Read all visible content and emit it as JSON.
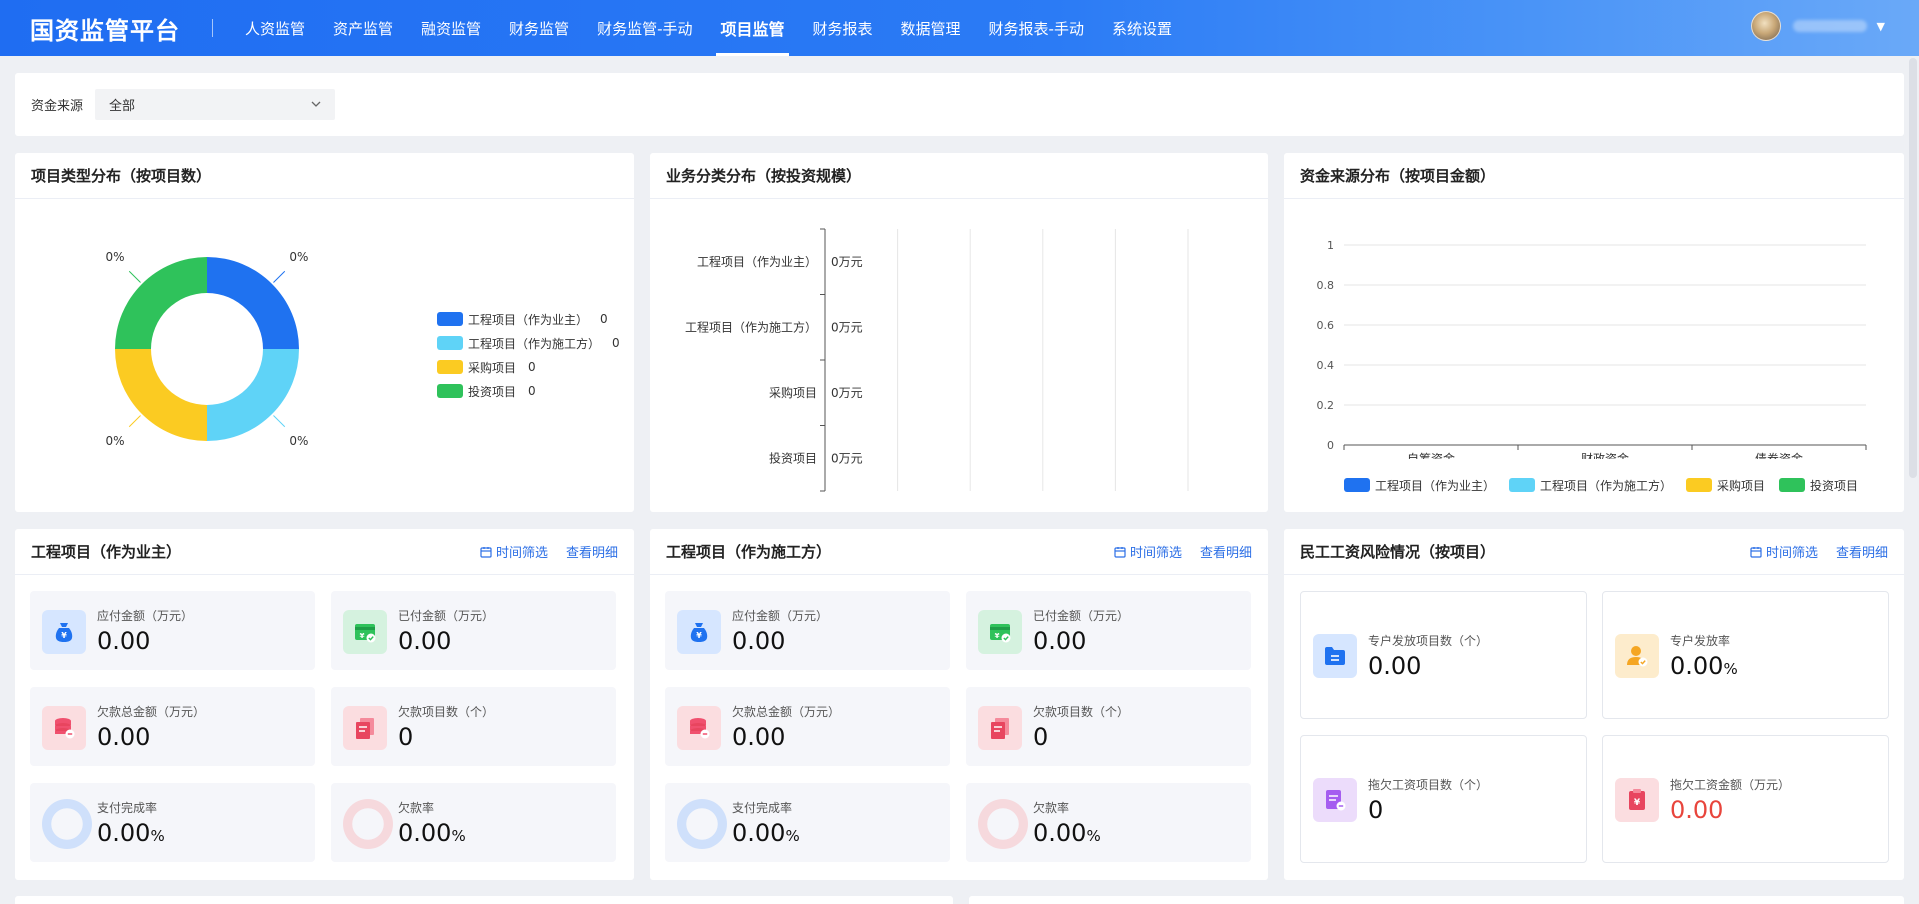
{
  "app": {
    "title": "国资监管平台"
  },
  "nav": [
    {
      "label": "人资监管",
      "active": false
    },
    {
      "label": "资产监管",
      "active": false
    },
    {
      "label": "融资监管",
      "active": false
    },
    {
      "label": "财务监管",
      "active": false
    },
    {
      "label": "财务监管-手动",
      "active": false
    },
    {
      "label": "项目监管",
      "active": true
    },
    {
      "label": "财务报表",
      "active": false
    },
    {
      "label": "数据管理",
      "active": false
    },
    {
      "label": "财务报表-手动",
      "active": false
    },
    {
      "label": "系统设置",
      "active": false
    }
  ],
  "filter": {
    "label": "资金来源",
    "value": "全部"
  },
  "colors": {
    "blue": "#1f72f0",
    "cyan": "#5fd3f7",
    "yellow": "#fbcb22",
    "green": "#2fc25b",
    "link": "#2c6fe6",
    "red": "#e8453c"
  },
  "panel1": {
    "title": "项目类型分布（按项目数）",
    "chart_data": {
      "type": "pie",
      "variant": "donut",
      "labels": [
        "工程项目（作为业主）",
        "工程项目（作为施工方）",
        "采购项目",
        "投资项目"
      ],
      "values": [
        0,
        0,
        0,
        0
      ],
      "slice_labels": [
        "0%",
        "0%",
        "0%",
        "0%"
      ],
      "legend_position": "right"
    }
  },
  "panel2": {
    "title": "业务分类分布（按投资规模）",
    "chart_data": {
      "type": "bar",
      "orientation": "horizontal",
      "categories": [
        "工程项目（作为业主）",
        "工程项目（作为施工方）",
        "采购项目",
        "投资项目"
      ],
      "values": [
        0,
        0,
        0,
        0
      ],
      "value_labels": [
        "0万元",
        "0万元",
        "0万元",
        "0万元"
      ],
      "xlim": [
        0,
        1
      ],
      "xticks": [
        "0",
        "0.2",
        "0.4",
        "0.6",
        "0.8",
        "1"
      ],
      "grid": true
    }
  },
  "panel3": {
    "title": "资金来源分布（按项目金额）",
    "chart_data": {
      "type": "bar",
      "categories": [
        "自筹资金",
        "财政资金",
        "债券资金"
      ],
      "series": [
        {
          "name": "工程项目（作为业主）",
          "values": [
            0,
            0,
            0
          ]
        },
        {
          "name": "工程项目（作为施工方）",
          "values": [
            0,
            0,
            0
          ]
        },
        {
          "name": "采购项目",
          "values": [
            0,
            0,
            0
          ]
        },
        {
          "name": "投资项目",
          "values": [
            0,
            0,
            0
          ]
        }
      ],
      "ylim": [
        0,
        1
      ],
      "yticks": [
        "0",
        "0.2",
        "0.4",
        "0.6",
        "0.8",
        "1"
      ],
      "grid": true,
      "legend_position": "bottom"
    }
  },
  "panel4": {
    "title": "工程项目（作为业主）",
    "filter_label": "时间筛选",
    "detail_label": "查看明细",
    "stats": [
      {
        "label": "应付金额（万元）",
        "value": "0.00"
      },
      {
        "label": "已付金额（万元）",
        "value": "0.00"
      },
      {
        "label": "欠款总金额（万元）",
        "value": "0.00"
      },
      {
        "label": "欠款项目数（个）",
        "value": "0"
      },
      {
        "label": "支付完成率",
        "value": "0.00",
        "unit": "%"
      },
      {
        "label": "欠款率",
        "value": "0.00",
        "unit": "%"
      }
    ]
  },
  "panel5": {
    "title": "工程项目（作为施工方）",
    "filter_label": "时间筛选",
    "detail_label": "查看明细",
    "stats": [
      {
        "label": "应付金额（万元）",
        "value": "0.00"
      },
      {
        "label": "已付金额（万元）",
        "value": "0.00"
      },
      {
        "label": "欠款总金额（万元）",
        "value": "0.00"
      },
      {
        "label": "欠款项目数（个）",
        "value": "0"
      },
      {
        "label": "支付完成率",
        "value": "0.00",
        "unit": "%"
      },
      {
        "label": "欠款率",
        "value": "0.00",
        "unit": "%"
      }
    ]
  },
  "panel6": {
    "title": "民工工资风险情况（按项目）",
    "filter_label": "时间筛选",
    "detail_label": "查看明细",
    "stats": [
      {
        "label": "专户发放项目数（个）",
        "value": "0.00"
      },
      {
        "label": "专户发放率",
        "value": "0.00",
        "unit": "%"
      },
      {
        "label": "拖欠工资项目数（个）",
        "value": "0"
      },
      {
        "label": "拖欠工资金额（万元）",
        "value": "0.00"
      }
    ]
  }
}
